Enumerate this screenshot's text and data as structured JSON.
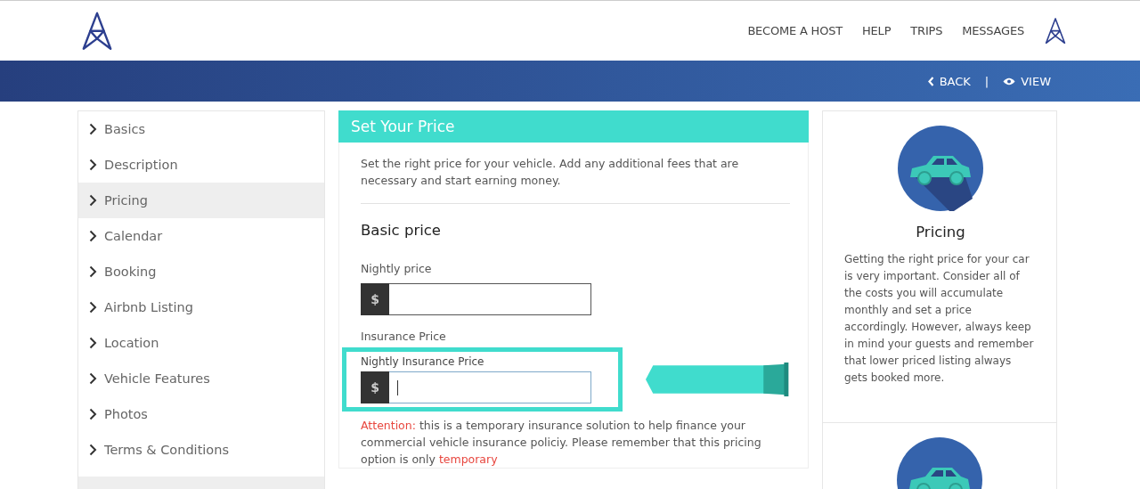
{
  "header": {
    "nav": [
      "BECOME A HOST",
      "HELP",
      "TRIPS",
      "MESSAGES"
    ]
  },
  "subbar": {
    "back": "BACK",
    "separator": "|",
    "view": "VIEW"
  },
  "sidebar": {
    "items": [
      {
        "label": "Basics",
        "selected": false
      },
      {
        "label": "Description",
        "selected": false
      },
      {
        "label": "Pricing",
        "selected": true
      },
      {
        "label": "Calendar",
        "selected": false
      },
      {
        "label": "Booking",
        "selected": false
      },
      {
        "label": "Airbnb Listing",
        "selected": false
      },
      {
        "label": "Location",
        "selected": false
      },
      {
        "label": "Vehicle Features",
        "selected": false
      },
      {
        "label": "Photos",
        "selected": false
      },
      {
        "label": "Terms & Conditions",
        "selected": false
      }
    ]
  },
  "form": {
    "title": "Set Your Price",
    "intro": "Set the right price for your vehicle. Add any additional fees that are necessary and start earning money.",
    "section": "Basic price",
    "nightly": {
      "label": "Nightly price",
      "prefix": "$",
      "focused": false
    },
    "insurance_heading": "Insurance Price",
    "insurance": {
      "label": "Nightly Insurance Price",
      "prefix": "$",
      "focused": true
    },
    "attention": [
      {
        "text": "Attention:",
        "kind": "alert"
      },
      {
        "text": " this is a temporary insurance solution to help finance your commercial vehicle insurance policiy. Please remember that this pricing option is only ",
        "kind": "plain"
      },
      {
        "text": "temporary",
        "kind": "alert"
      }
    ]
  },
  "help_card": {
    "title": "Pricing",
    "body": "Getting the right price for your car is very important. Consider all of the costs you will accumulate monthly and set a price accordingly. However, always keep in mind your guests and remember that lower priced listing always gets booked more."
  }
}
